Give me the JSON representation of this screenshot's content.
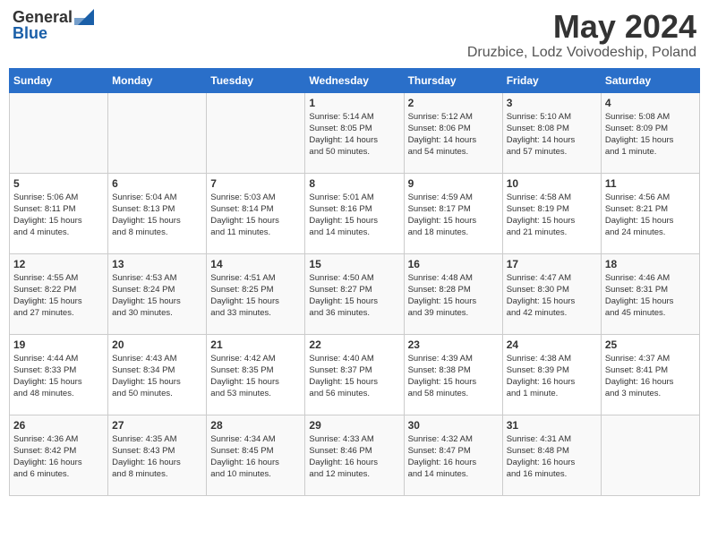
{
  "header": {
    "logo_general": "General",
    "logo_blue": "Blue",
    "title": "May 2024",
    "location": "Druzbice, Lodz Voivodeship, Poland"
  },
  "days_of_week": [
    "Sunday",
    "Monday",
    "Tuesday",
    "Wednesday",
    "Thursday",
    "Friday",
    "Saturday"
  ],
  "weeks": [
    [
      {
        "day": "",
        "info": ""
      },
      {
        "day": "",
        "info": ""
      },
      {
        "day": "",
        "info": ""
      },
      {
        "day": "1",
        "info": "Sunrise: 5:14 AM\nSunset: 8:05 PM\nDaylight: 14 hours\nand 50 minutes."
      },
      {
        "day": "2",
        "info": "Sunrise: 5:12 AM\nSunset: 8:06 PM\nDaylight: 14 hours\nand 54 minutes."
      },
      {
        "day": "3",
        "info": "Sunrise: 5:10 AM\nSunset: 8:08 PM\nDaylight: 14 hours\nand 57 minutes."
      },
      {
        "day": "4",
        "info": "Sunrise: 5:08 AM\nSunset: 8:09 PM\nDaylight: 15 hours\nand 1 minute."
      }
    ],
    [
      {
        "day": "5",
        "info": "Sunrise: 5:06 AM\nSunset: 8:11 PM\nDaylight: 15 hours\nand 4 minutes."
      },
      {
        "day": "6",
        "info": "Sunrise: 5:04 AM\nSunset: 8:13 PM\nDaylight: 15 hours\nand 8 minutes."
      },
      {
        "day": "7",
        "info": "Sunrise: 5:03 AM\nSunset: 8:14 PM\nDaylight: 15 hours\nand 11 minutes."
      },
      {
        "day": "8",
        "info": "Sunrise: 5:01 AM\nSunset: 8:16 PM\nDaylight: 15 hours\nand 14 minutes."
      },
      {
        "day": "9",
        "info": "Sunrise: 4:59 AM\nSunset: 8:17 PM\nDaylight: 15 hours\nand 18 minutes."
      },
      {
        "day": "10",
        "info": "Sunrise: 4:58 AM\nSunset: 8:19 PM\nDaylight: 15 hours\nand 21 minutes."
      },
      {
        "day": "11",
        "info": "Sunrise: 4:56 AM\nSunset: 8:21 PM\nDaylight: 15 hours\nand 24 minutes."
      }
    ],
    [
      {
        "day": "12",
        "info": "Sunrise: 4:55 AM\nSunset: 8:22 PM\nDaylight: 15 hours\nand 27 minutes."
      },
      {
        "day": "13",
        "info": "Sunrise: 4:53 AM\nSunset: 8:24 PM\nDaylight: 15 hours\nand 30 minutes."
      },
      {
        "day": "14",
        "info": "Sunrise: 4:51 AM\nSunset: 8:25 PM\nDaylight: 15 hours\nand 33 minutes."
      },
      {
        "day": "15",
        "info": "Sunrise: 4:50 AM\nSunset: 8:27 PM\nDaylight: 15 hours\nand 36 minutes."
      },
      {
        "day": "16",
        "info": "Sunrise: 4:48 AM\nSunset: 8:28 PM\nDaylight: 15 hours\nand 39 minutes."
      },
      {
        "day": "17",
        "info": "Sunrise: 4:47 AM\nSunset: 8:30 PM\nDaylight: 15 hours\nand 42 minutes."
      },
      {
        "day": "18",
        "info": "Sunrise: 4:46 AM\nSunset: 8:31 PM\nDaylight: 15 hours\nand 45 minutes."
      }
    ],
    [
      {
        "day": "19",
        "info": "Sunrise: 4:44 AM\nSunset: 8:33 PM\nDaylight: 15 hours\nand 48 minutes."
      },
      {
        "day": "20",
        "info": "Sunrise: 4:43 AM\nSunset: 8:34 PM\nDaylight: 15 hours\nand 50 minutes."
      },
      {
        "day": "21",
        "info": "Sunrise: 4:42 AM\nSunset: 8:35 PM\nDaylight: 15 hours\nand 53 minutes."
      },
      {
        "day": "22",
        "info": "Sunrise: 4:40 AM\nSunset: 8:37 PM\nDaylight: 15 hours\nand 56 minutes."
      },
      {
        "day": "23",
        "info": "Sunrise: 4:39 AM\nSunset: 8:38 PM\nDaylight: 15 hours\nand 58 minutes."
      },
      {
        "day": "24",
        "info": "Sunrise: 4:38 AM\nSunset: 8:39 PM\nDaylight: 16 hours\nand 1 minute."
      },
      {
        "day": "25",
        "info": "Sunrise: 4:37 AM\nSunset: 8:41 PM\nDaylight: 16 hours\nand 3 minutes."
      }
    ],
    [
      {
        "day": "26",
        "info": "Sunrise: 4:36 AM\nSunset: 8:42 PM\nDaylight: 16 hours\nand 6 minutes."
      },
      {
        "day": "27",
        "info": "Sunrise: 4:35 AM\nSunset: 8:43 PM\nDaylight: 16 hours\nand 8 minutes."
      },
      {
        "day": "28",
        "info": "Sunrise: 4:34 AM\nSunset: 8:45 PM\nDaylight: 16 hours\nand 10 minutes."
      },
      {
        "day": "29",
        "info": "Sunrise: 4:33 AM\nSunset: 8:46 PM\nDaylight: 16 hours\nand 12 minutes."
      },
      {
        "day": "30",
        "info": "Sunrise: 4:32 AM\nSunset: 8:47 PM\nDaylight: 16 hours\nand 14 minutes."
      },
      {
        "day": "31",
        "info": "Sunrise: 4:31 AM\nSunset: 8:48 PM\nDaylight: 16 hours\nand 16 minutes."
      },
      {
        "day": "",
        "info": ""
      }
    ]
  ]
}
